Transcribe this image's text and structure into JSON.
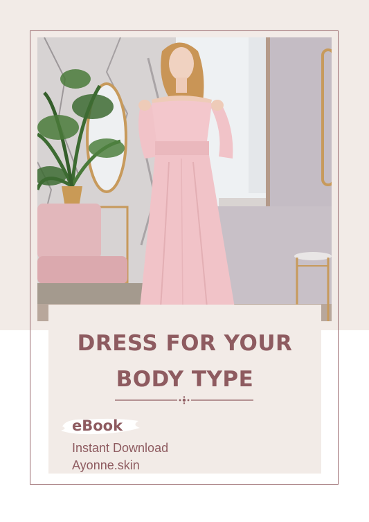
{
  "cover": {
    "title_line1": "DRESS FOR YOUR",
    "title_line2": "BODY TYPE",
    "badge": "eBook",
    "subtitle": "Instant Download",
    "website": "Ayonne.skin"
  },
  "colors": {
    "accent": "#8e5b60",
    "background": "#f2ebe7",
    "dress": "#f1c3c8",
    "frame": "#9a6a6e"
  },
  "photo": {
    "subject": "woman-in-pink-dress",
    "icons": [
      "palm-plant-icon",
      "oval-mirror-icon",
      "pink-chair-icon",
      "side-table-icon"
    ]
  }
}
